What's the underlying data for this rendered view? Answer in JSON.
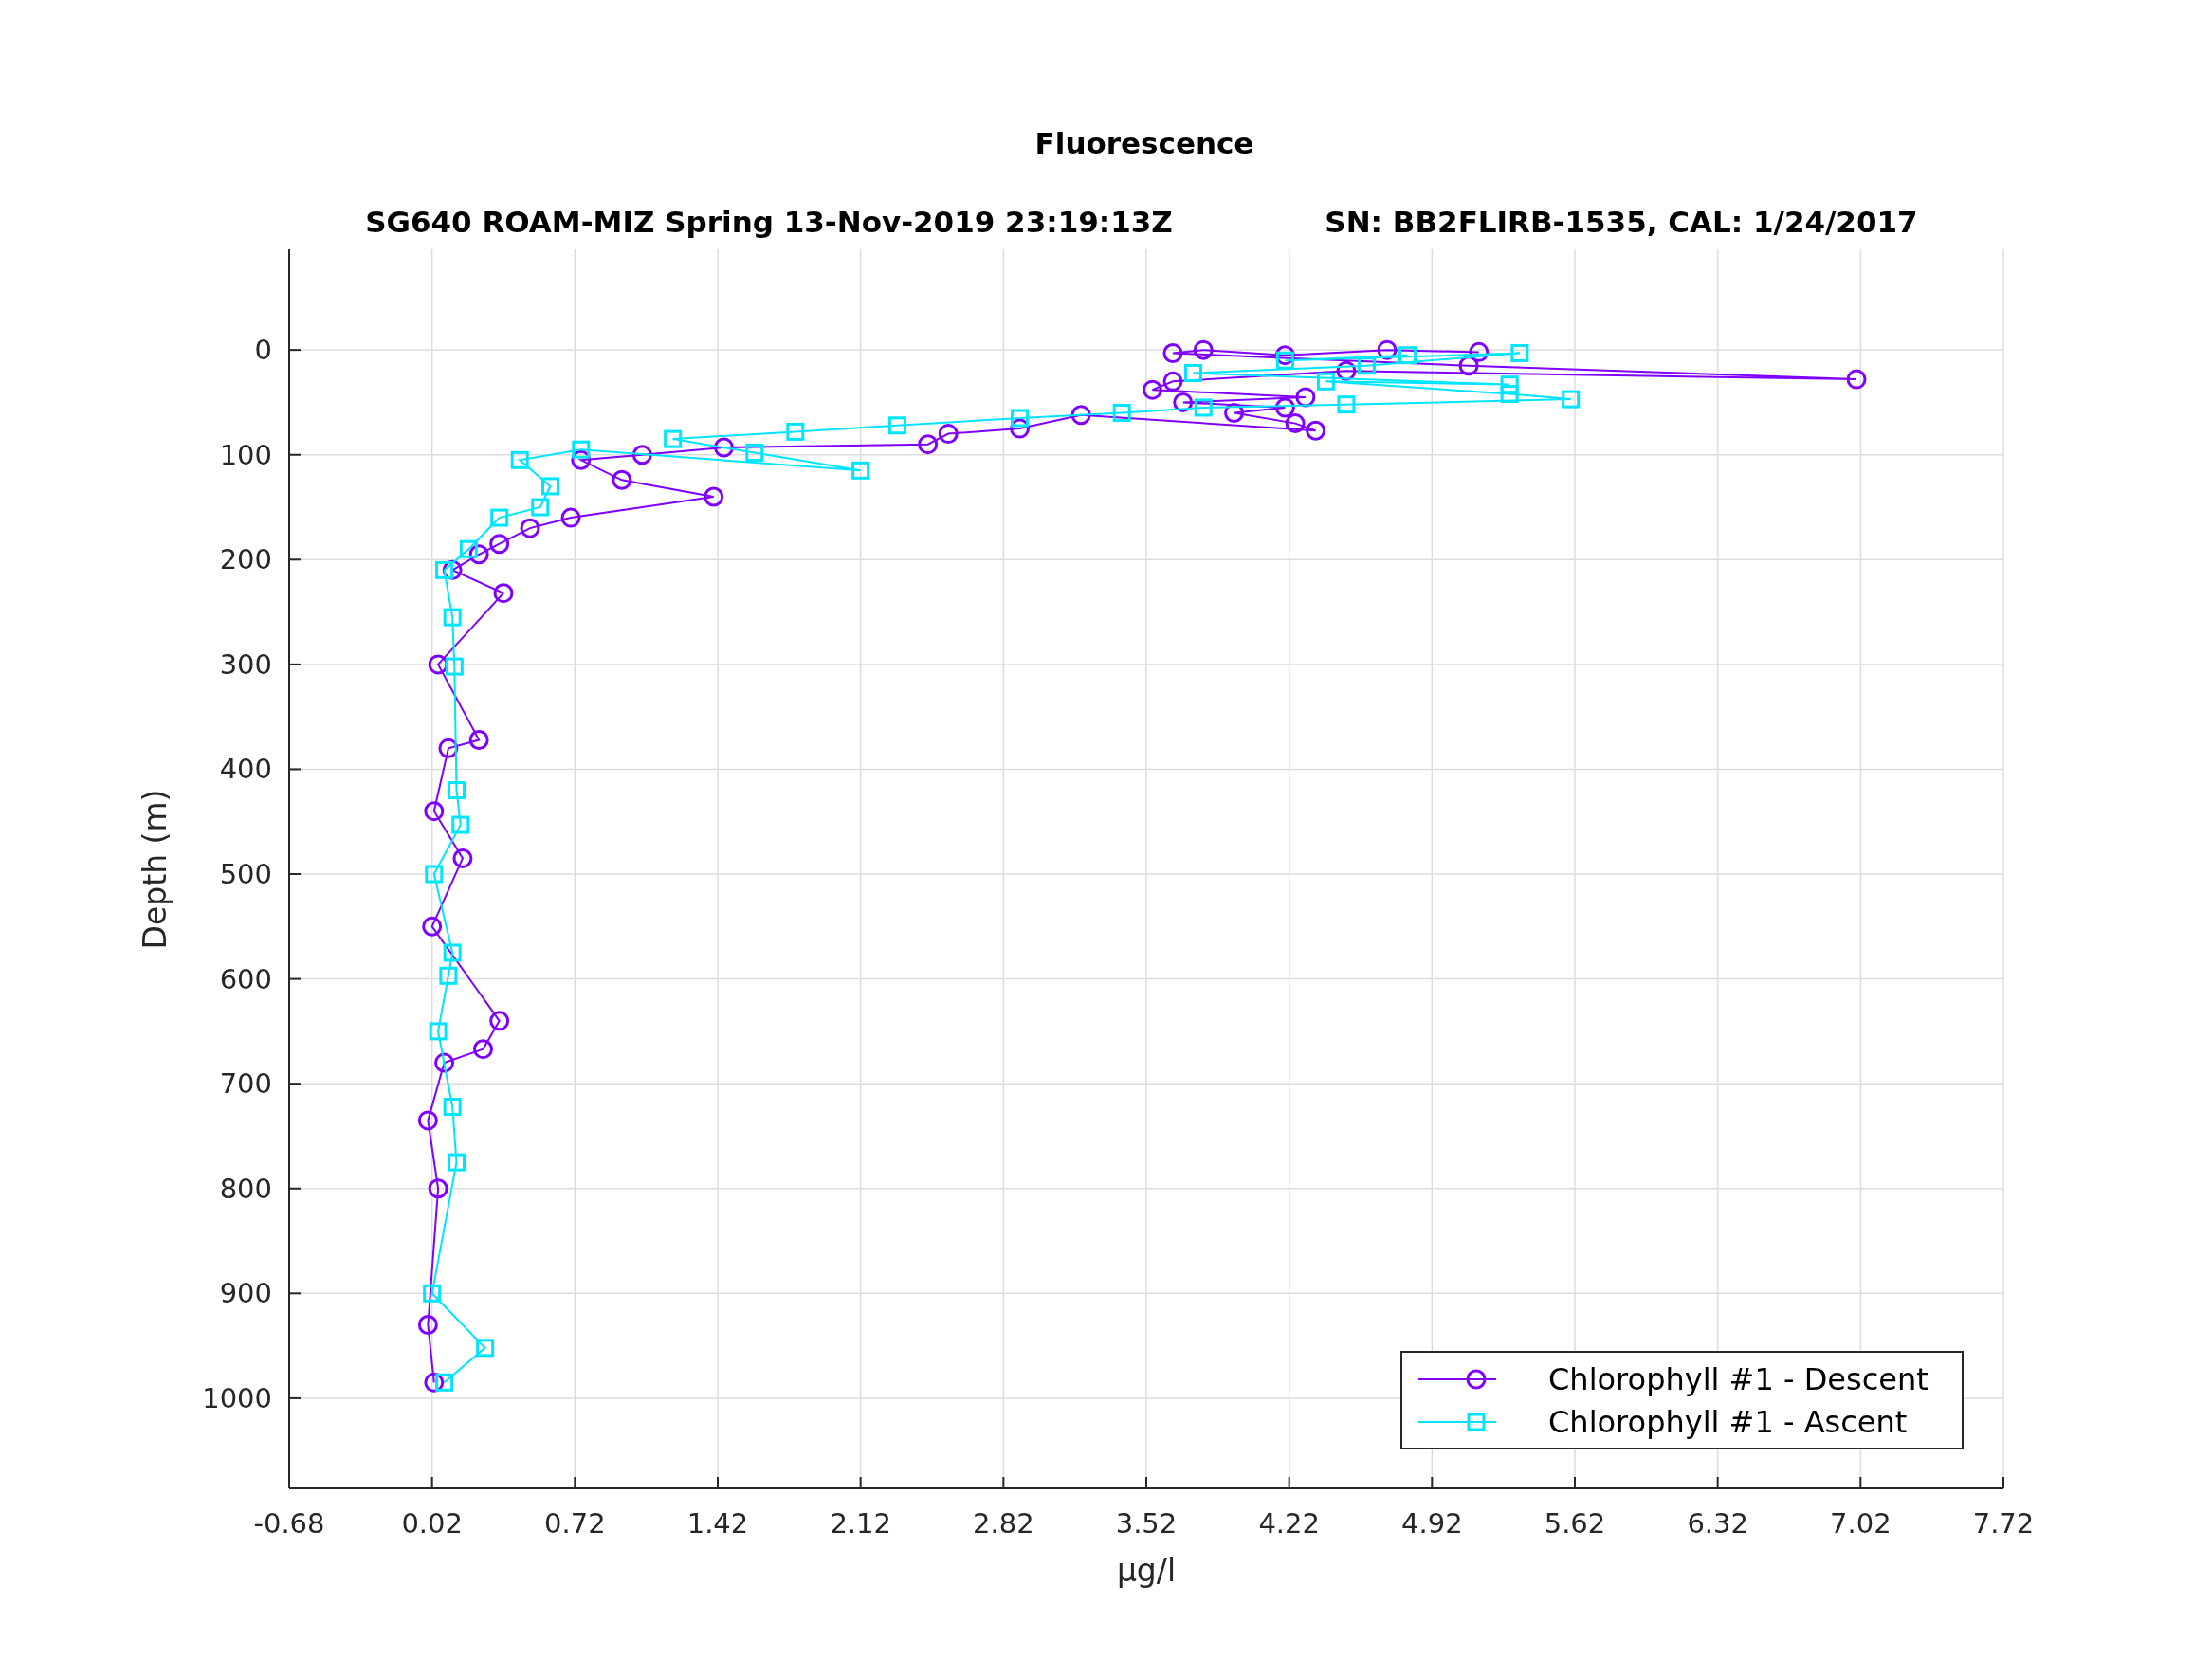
{
  "figure": {
    "subtitles": [
      "SG640 ROAM-MIZ Spring 13-Nov-2019 23:19:13Z",
      "SN: BB2FLIRB-1535, CAL: 1/24/2017"
    ],
    "chart_data": {
      "type": "line",
      "title": "Fluorescence",
      "xlabel": "μg/l",
      "ylabel": "Depth (m)",
      "xlim": [
        -0.68,
        7.72
      ],
      "ylim": [
        1086,
        -96
      ],
      "grid": true,
      "legend": true,
      "xticks": [
        {
          "value": -0.68,
          "label": "-0.68"
        },
        {
          "value": 0.02,
          "label": "0.02"
        },
        {
          "value": 0.72,
          "label": "0.72"
        },
        {
          "value": 1.42,
          "label": "1.42"
        },
        {
          "value": 2.12,
          "label": "2.12"
        },
        {
          "value": 2.82,
          "label": "2.82"
        },
        {
          "value": 3.52,
          "label": "3.52"
        },
        {
          "value": 4.22,
          "label": "4.22"
        },
        {
          "value": 4.92,
          "label": "4.92"
        },
        {
          "value": 5.62,
          "label": "5.62"
        },
        {
          "value": 6.32,
          "label": "6.32"
        },
        {
          "value": 7.02,
          "label": "7.02"
        },
        {
          "value": 7.72,
          "label": "7.72"
        }
      ],
      "yticks": [
        {
          "value": 0,
          "label": "0"
        },
        {
          "value": 100,
          "label": "100"
        },
        {
          "value": 200,
          "label": "200"
        },
        {
          "value": 300,
          "label": "300"
        },
        {
          "value": 400,
          "label": "400"
        },
        {
          "value": 500,
          "label": "500"
        },
        {
          "value": 600,
          "label": "600"
        },
        {
          "value": 700,
          "label": "700"
        },
        {
          "value": 800,
          "label": "800"
        },
        {
          "value": 900,
          "label": "900"
        },
        {
          "value": 1000,
          "label": "1000"
        }
      ],
      "series": [
        {
          "name": "Chlorophyll #1 - Descent",
          "color": "#7f00ff",
          "marker": "circle",
          "x": [
            5.15,
            4.7,
            4.2,
            3.8,
            3.65,
            5.1,
            7.0,
            4.5,
            3.65,
            3.55,
            4.3,
            3.7,
            4.2,
            3.95,
            4.25,
            4.35,
            3.2,
            2.9,
            2.55,
            2.45,
            1.45,
            1.05,
            0.75,
            0.95,
            1.4,
            0.7,
            0.5,
            0.35,
            0.25,
            0.12,
            0.37,
            0.05,
            0.25,
            0.1,
            0.03,
            0.17,
            0.02,
            0.35,
            0.27,
            0.08,
            0.0,
            0.05,
            0.0,
            0.03
          ],
          "values": [
            2,
            0,
            5,
            0,
            3,
            15,
            28,
            20,
            30,
            38,
            45,
            50,
            55,
            60,
            70,
            77,
            62,
            75,
            80,
            90,
            93,
            100,
            105,
            124,
            140,
            160,
            170,
            185,
            195,
            210,
            232,
            300,
            372,
            380,
            440,
            485,
            550,
            640,
            667,
            680,
            735,
            800,
            930,
            985
          ]
        },
        {
          "name": "Chlorophyll #1 - Ascent",
          "color": "#00e5ff",
          "marker": "square",
          "x": [
            0.08,
            0.28,
            0.02,
            0.14,
            0.12,
            0.05,
            0.1,
            0.12,
            0.03,
            0.16,
            0.14,
            0.13,
            0.12,
            0.08,
            0.2,
            0.35,
            0.55,
            0.6,
            0.45,
            0.75,
            2.12,
            1.6,
            1.2,
            1.8,
            2.3,
            2.9,
            3.4,
            3.8,
            4.5,
            5.6,
            5.3,
            4.4,
            5.3,
            3.75,
            4.6,
            5.35,
            4.2,
            4.8
          ],
          "values": [
            985,
            952,
            900,
            775,
            722,
            650,
            597,
            575,
            500,
            453,
            420,
            302,
            255,
            210,
            190,
            160,
            150,
            130,
            105,
            95,
            115,
            98,
            85,
            78,
            72,
            65,
            60,
            55,
            52,
            47,
            42,
            30,
            33,
            22,
            15,
            3,
            10,
            5
          ]
        }
      ]
    }
  }
}
